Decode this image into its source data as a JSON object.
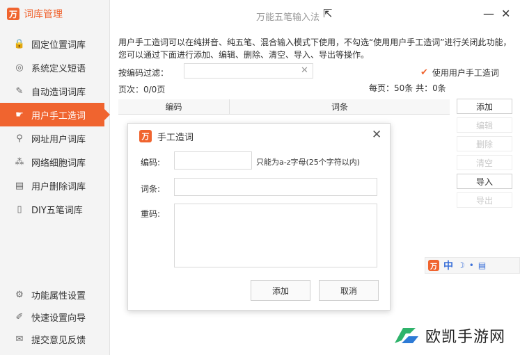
{
  "brand": {
    "logo_glyph": "万",
    "title": "词库管理"
  },
  "sidebar": {
    "items": [
      {
        "label": "固定位置词库",
        "icon": "lock-icon",
        "glyph": "🔒"
      },
      {
        "label": "系统定义短语",
        "icon": "target-icon",
        "glyph": "◎"
      },
      {
        "label": "自动造词词库",
        "icon": "edit-icon",
        "glyph": "✎"
      },
      {
        "label": "用户手工造词",
        "icon": "hand-icon",
        "glyph": "☛",
        "active": true
      },
      {
        "label": "网址用户词库",
        "icon": "link-icon",
        "glyph": "⚲"
      },
      {
        "label": "网络细胞词库",
        "icon": "cells-icon",
        "glyph": "⁂"
      },
      {
        "label": "用户删除词库",
        "icon": "delete-list-icon",
        "glyph": "▤"
      },
      {
        "label": "DIY五笔词库",
        "icon": "doc-icon",
        "glyph": "▯"
      }
    ],
    "bottom_items": [
      {
        "label": "功能属性设置",
        "icon": "gear-icon",
        "glyph": "⚙"
      },
      {
        "label": "快速设置向导",
        "icon": "wizard-icon",
        "glyph": "✐"
      },
      {
        "label": "提交意见反馈",
        "icon": "feedback-icon",
        "glyph": "✉"
      }
    ]
  },
  "window": {
    "title": "万能五笔输入法",
    "minimize": "—",
    "close": "✕"
  },
  "main": {
    "description": "用户手工造词可以在纯拼音、纯五笔、混合输入模式下使用，不勾选“使用用户手工造词”进行关闭此功能，您可以通过下面进行添加、编辑、删除、清空、导入、导出等操作。",
    "filter_label": "按编码过滤：",
    "filter_value": "",
    "filter_clear": "✕",
    "use_manual_label": "使用用户手工造词",
    "use_manual_checked": true,
    "page_info": "页次：0/0页",
    "page_meta": "每页：50条 共：0条",
    "columns": [
      "编码",
      "词条"
    ],
    "buttons": {
      "add": "添加",
      "edit": "编辑",
      "delete": "删除",
      "clear": "清空",
      "import": "导入",
      "export": "导出"
    }
  },
  "ime_bar": {
    "zh": "中",
    "glyphs": [
      "☽",
      "•",
      "▤"
    ]
  },
  "watermark": {
    "text": "欧凯手游网"
  },
  "dialog": {
    "title": "手工造词",
    "close": "✕",
    "code_label": "编码:",
    "code_value": "",
    "code_hint": "只能为a-z字母(25个字符以内)",
    "entry_label": "词条:",
    "entry_value": "",
    "dup_label": "重码:",
    "dup_value": "",
    "add": "添加",
    "cancel": "取消"
  },
  "colors": {
    "accent": "#f0642f",
    "ime_blue": "#3a6fd8"
  }
}
